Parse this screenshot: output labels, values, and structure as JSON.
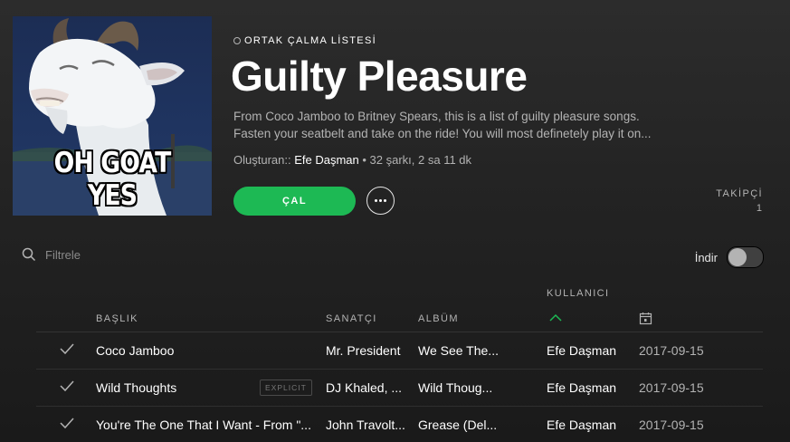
{
  "cover": {
    "caption": "OH GOAT YES"
  },
  "header": {
    "kicker": "ORTAK ÇALMA LİSTESİ",
    "title": "Guilty Pleasure",
    "description": "From Coco Jamboo to Britney Spears, this is a list of guilty pleasure songs. Fasten your seatbelt and take on the ride! You will most definetely play it on...",
    "created_by_label": "Oluşturan::",
    "owner": "Efe Daşman",
    "stats": "• 32 şarkı, 2 sa 11 dk"
  },
  "actions": {
    "play_label": "ÇAL",
    "more_icon": "more-icon",
    "followers_label": "TAKİPÇİ",
    "followers_count": "1"
  },
  "filter": {
    "placeholder": "Filtrele",
    "value": "",
    "icon": "search-icon"
  },
  "download": {
    "label": "İndir",
    "enabled": false
  },
  "table": {
    "columns": {
      "title": "BAŞLIK",
      "artist": "SANATÇI",
      "album": "ALBÜM",
      "user": "KULLANICI",
      "date_icon": "calendar-icon",
      "sort_icon": "sort-ascending-icon"
    },
    "rows": [
      {
        "title": "Coco Jamboo",
        "explicit": "",
        "artist": "Mr. President",
        "album": "We See The...",
        "user": "Efe Daşman",
        "date": "2017-09-15"
      },
      {
        "title": "Wild Thoughts",
        "explicit": "EXPLICIT",
        "artist": "DJ Khaled, ...",
        "album": "Wild Thoug...",
        "user": "Efe Daşman",
        "date": "2017-09-15"
      },
      {
        "title": "You're The One That I Want - From \"...",
        "explicit": "",
        "artist": "John Travolt...",
        "album": "Grease (Del...",
        "user": "Efe Daşman",
        "date": "2017-09-15"
      }
    ]
  },
  "colors": {
    "accent": "#1db954",
    "text_dim": "#b3b3b3"
  }
}
